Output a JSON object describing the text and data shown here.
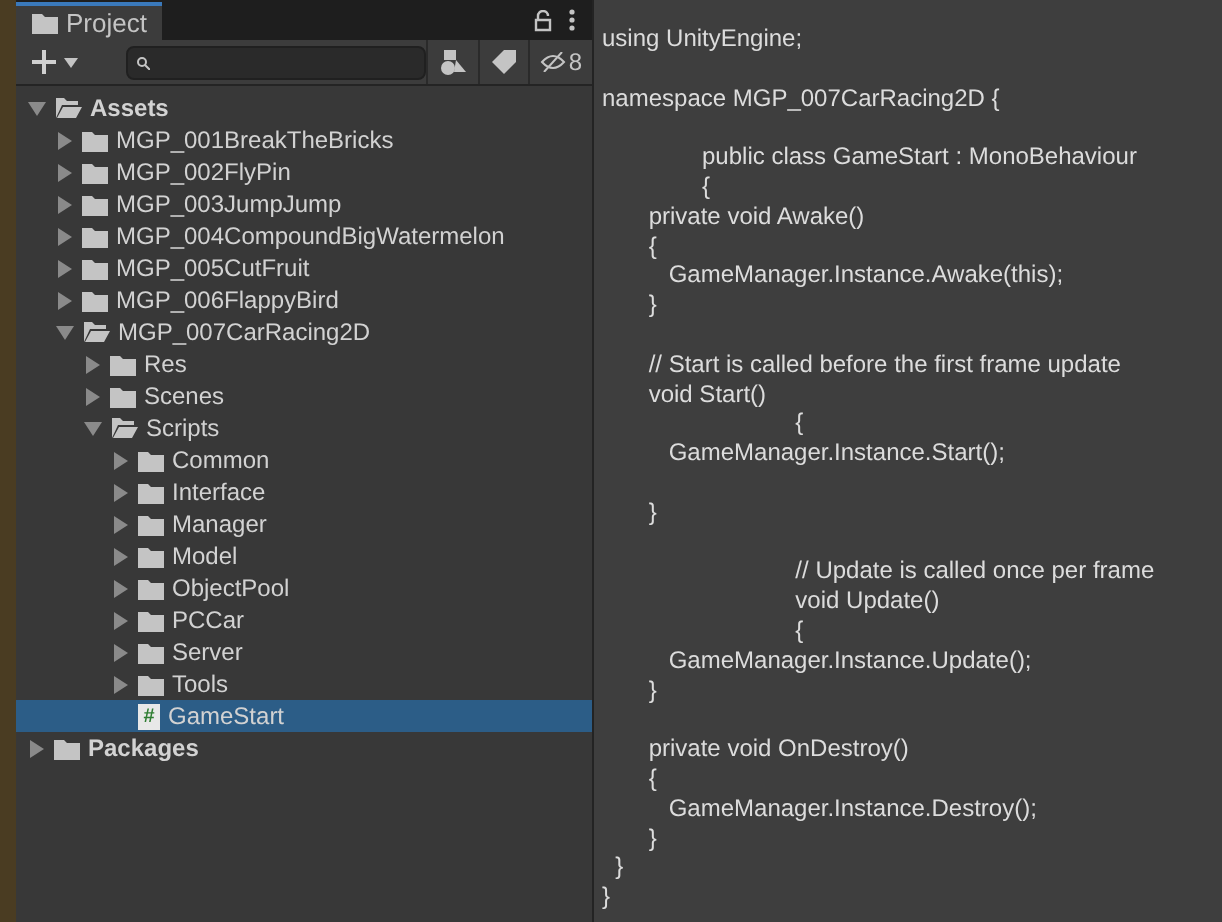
{
  "panel": {
    "tab": {
      "label": "Project",
      "selected": true
    },
    "toolbar": {
      "hidden_count": "8"
    },
    "tree": [
      {
        "label": "Assets",
        "kind": "folder",
        "expanded": true,
        "selected": false,
        "children": [
          {
            "label": "MGP_001BreakTheBricks",
            "kind": "folder",
            "expanded": false,
            "selected": false
          },
          {
            "label": "MGP_002FlyPin",
            "kind": "folder",
            "expanded": false,
            "selected": false
          },
          {
            "label": "MGP_003JumpJump",
            "kind": "folder",
            "expanded": false,
            "selected": false
          },
          {
            "label": "MGP_004CompoundBigWatermelon",
            "kind": "folder",
            "expanded": false,
            "selected": false
          },
          {
            "label": "MGP_005CutFruit",
            "kind": "folder",
            "expanded": false,
            "selected": false
          },
          {
            "label": "MGP_006FlappyBird",
            "kind": "folder",
            "expanded": false,
            "selected": false
          },
          {
            "label": "MGP_007CarRacing2D",
            "kind": "folder",
            "expanded": true,
            "selected": false,
            "children": [
              {
                "label": "Res",
                "kind": "folder",
                "expanded": false,
                "selected": false
              },
              {
                "label": "Scenes",
                "kind": "folder",
                "expanded": false,
                "selected": false
              },
              {
                "label": "Scripts",
                "kind": "folder",
                "expanded": true,
                "selected": false,
                "children": [
                  {
                    "label": "Common",
                    "kind": "folder",
                    "expanded": false,
                    "selected": false
                  },
                  {
                    "label": "Interface",
                    "kind": "folder",
                    "expanded": false,
                    "selected": false
                  },
                  {
                    "label": "Manager",
                    "kind": "folder",
                    "expanded": false,
                    "selected": false
                  },
                  {
                    "label": "Model",
                    "kind": "folder",
                    "expanded": false,
                    "selected": false
                  },
                  {
                    "label": "ObjectPool",
                    "kind": "folder",
                    "expanded": false,
                    "selected": false
                  },
                  {
                    "label": "PCCar",
                    "kind": "folder",
                    "expanded": false,
                    "selected": false
                  },
                  {
                    "label": "Server",
                    "kind": "folder",
                    "expanded": false,
                    "selected": false
                  },
                  {
                    "label": "Tools",
                    "kind": "folder",
                    "expanded": false,
                    "selected": false
                  },
                  {
                    "label": "GameStart",
                    "kind": "script",
                    "icon": "#",
                    "selected": true
                  }
                ]
              }
            ]
          }
        ]
      },
      {
        "label": "Packages",
        "kind": "folder",
        "expanded": false,
        "selected": false
      }
    ]
  },
  "code": {
    "blocks": [
      [
        "using UnityEngine;"
      ],
      [
        "namespace MGP_007CarRacing2D {"
      ],
      [
        "               public class GameStart : MonoBehaviour",
        "               {",
        "       private void Awake()",
        "       {",
        "          GameManager.Instance.Awake(this);",
        "       }"
      ],
      [
        "       // Start is called before the first frame update",
        "       void Start()",
        "                             {",
        "          GameManager.Instance.Start();"
      ],
      [
        "       }"
      ],
      [
        "                             // Update is called once per frame",
        "                             void Update()",
        "                             {",
        "          GameManager.Instance.Update();",
        "       }"
      ],
      [
        "       private void OnDestroy()",
        "       {",
        "          GameManager.Instance.Destroy();",
        "       }",
        "  }",
        "}"
      ]
    ]
  }
}
